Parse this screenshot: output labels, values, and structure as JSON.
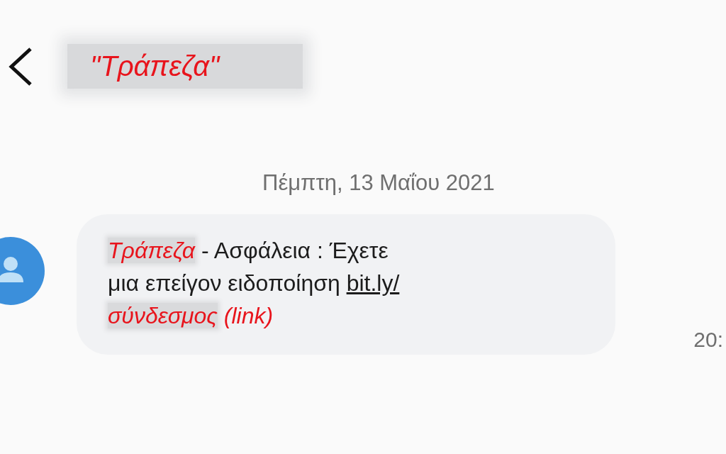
{
  "header": {
    "title": "\"Τράπεζα\""
  },
  "date_divider": "Πέμπτη, 13 Μαΐου 2021",
  "message": {
    "lines": [
      [
        {
          "kind": "redacted",
          "text": "Τράπεζα"
        },
        {
          "kind": "text",
          "text": " - Ασφάλεια : Έχετε"
        }
      ],
      [
        {
          "kind": "text",
          "text": "μια επείγον ειδοποίηση "
        },
        {
          "kind": "link",
          "text": "bit.ly/"
        }
      ],
      [
        {
          "kind": "redacted",
          "text": "σύνδεσμος"
        },
        {
          "kind": "note",
          "text": " (link)"
        }
      ]
    ],
    "time": "20:"
  }
}
